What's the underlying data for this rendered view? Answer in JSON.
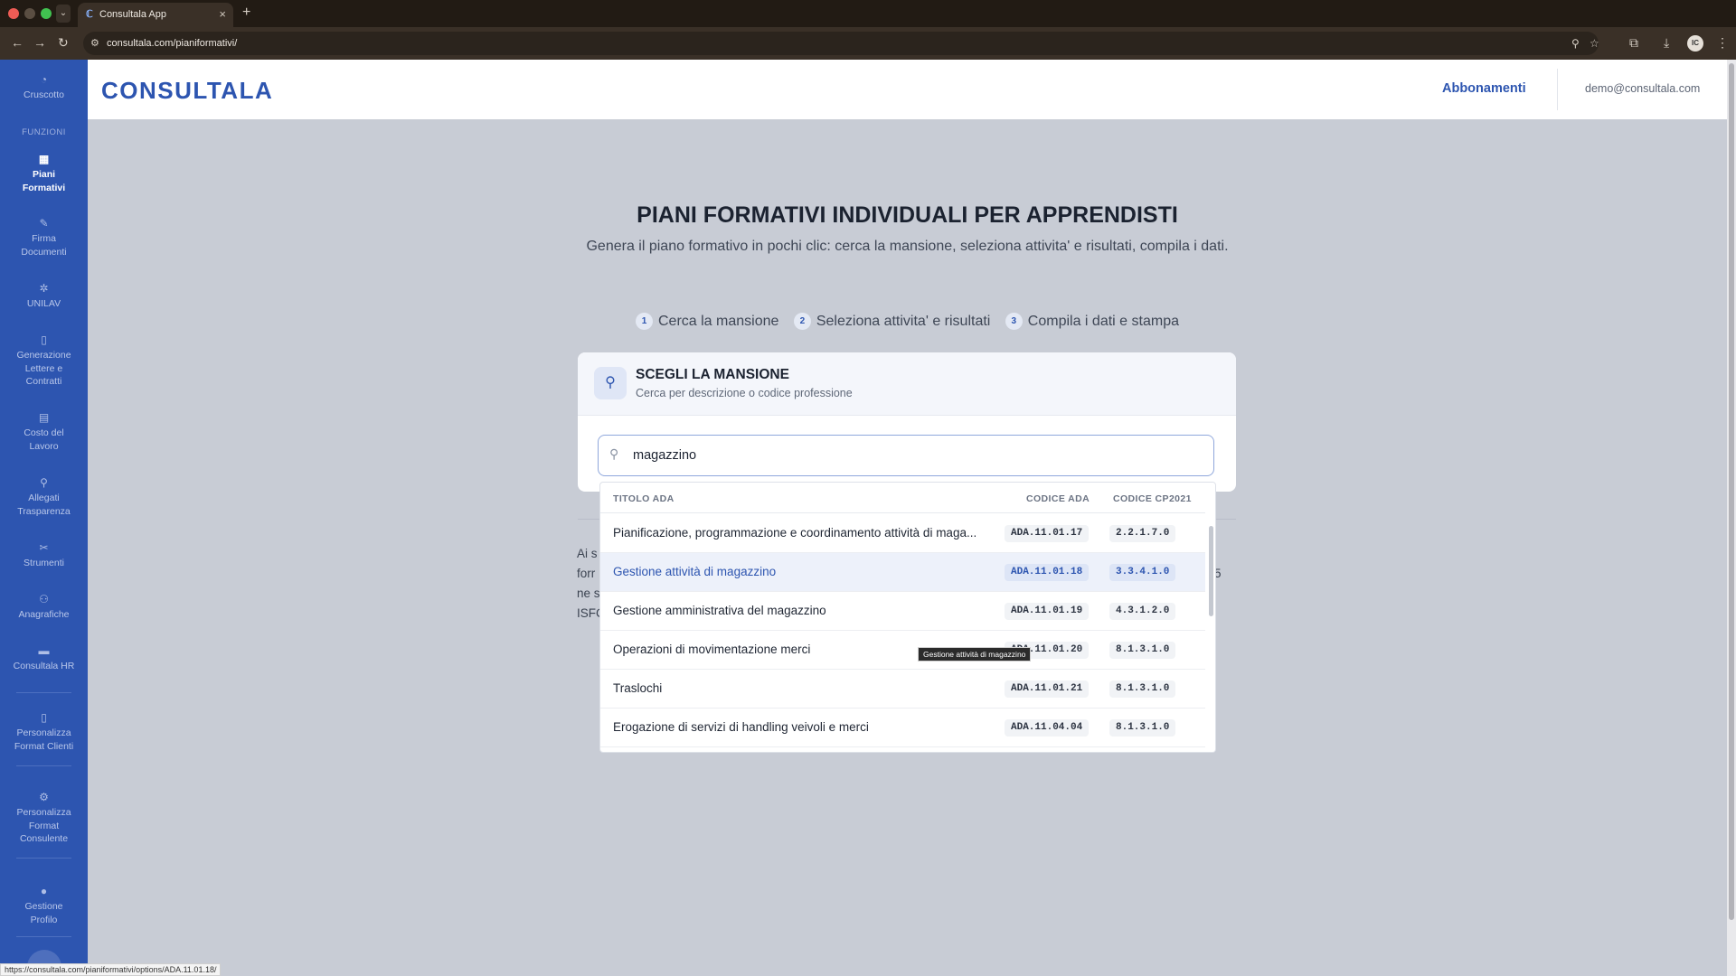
{
  "browser": {
    "tab_title": "Consultala App",
    "url": "consultala.com/pianiformativi/",
    "status_url": "https://consultala.com/pianiformativi/options/ADA.11.01.18/",
    "profile_initials": "IC"
  },
  "sidebar": {
    "section_label": "FUNZIONI",
    "items": [
      {
        "label": "Cruscotto",
        "icon": "dashboard-icon"
      },
      {
        "label": "Piani Formativi",
        "icon": "table-icon",
        "active": true
      },
      {
        "label": "Firma Documenti",
        "icon": "signature-icon"
      },
      {
        "label": "UNILAV",
        "icon": "cog-icon"
      },
      {
        "label": "Generazione Lettere e Contratti",
        "icon": "document-icon"
      },
      {
        "label": "Costo del Lavoro",
        "icon": "calculator-icon"
      },
      {
        "label": "Allegati Trasparenza",
        "icon": "search-icon"
      },
      {
        "label": "Strumenti",
        "icon": "tools-icon"
      },
      {
        "label": "Anagrafiche",
        "icon": "users-icon"
      },
      {
        "label": "Consultala HR",
        "icon": "folder-icon"
      },
      {
        "label": "Personalizza Format Clienti",
        "icon": "file-icon"
      },
      {
        "label": "Personalizza Format Consulente",
        "icon": "gear-icon"
      },
      {
        "label": "Gestione Profilo",
        "icon": "user-icon"
      }
    ]
  },
  "header": {
    "logo": "CONSULTALA",
    "nav_link": "Abbonamenti",
    "user_email": "demo@consultala.com"
  },
  "page": {
    "title": "PIANI FORMATIVI INDIVIDUALI PER APPRENDISTI",
    "subtitle": "Genera il piano formativo in pochi clic: cerca la mansione, seleziona attivita' e risultati, compila i dati.",
    "steps": [
      {
        "num": "1",
        "label": "Cerca la mansione"
      },
      {
        "num": "2",
        "label": "Seleziona attivita' e risultati"
      },
      {
        "num": "3",
        "label": "Compila i dati e stampa"
      }
    ]
  },
  "card": {
    "title": "SCEGLI LA MANSIONE",
    "subtitle": "Cerca per descrizione o codice professione",
    "search_value": "magazzino"
  },
  "behind": {
    "left_lines": [
      "Ai s",
      "forr",
      "ne s",
      "ISFC"
    ],
    "right_char": "5"
  },
  "dropdown": {
    "headers": {
      "title": "TITOLO ADA",
      "ada": "CODICE ADA",
      "cp": "CODICE CP2021"
    },
    "rows": [
      {
        "title": "Pianificazione, programmazione e coordinamento attività di maga...",
        "ada": "ADA.11.01.17",
        "cp": "2.2.1.7.0"
      },
      {
        "title": "Gestione attività di magazzino",
        "ada": "ADA.11.01.18",
        "cp": "3.3.4.1.0",
        "highlighted": true
      },
      {
        "title": "Gestione amministrativa del magazzino",
        "ada": "ADA.11.01.19",
        "cp": "4.3.1.2.0"
      },
      {
        "title": "Operazioni di movimentazione merci",
        "ada": "ADA.11.01.20",
        "cp": "8.1.3.1.0"
      },
      {
        "title": "Traslochi",
        "ada": "ADA.11.01.21",
        "cp": "8.1.3.1.0"
      },
      {
        "title": "Erogazione di servizi di handling veivoli e merci",
        "ada": "ADA.11.04.04",
        "cp": "8.1.3.1.0"
      }
    ]
  },
  "tooltip": "Gestione attività di magazzino",
  "colors": {
    "brand": "#2d55b0",
    "overlay_bg": "#c8ccd5"
  }
}
